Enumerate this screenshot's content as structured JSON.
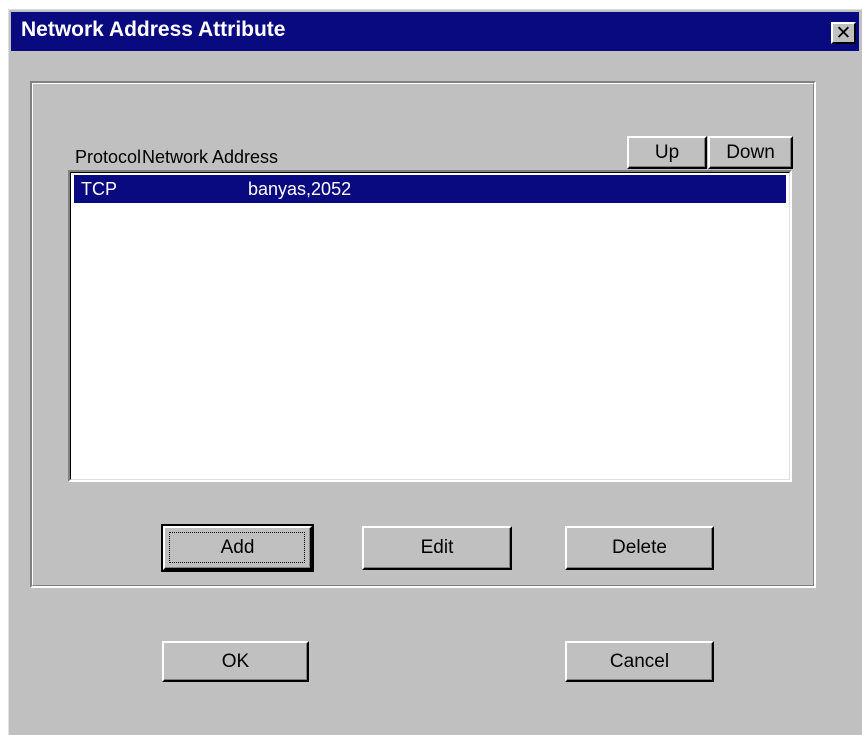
{
  "window": {
    "title": "Network Address Attribute",
    "close_glyph": "✕"
  },
  "list": {
    "headers": {
      "protocol": "Protocol",
      "address": "Network Address"
    },
    "rows": [
      {
        "protocol": "TCP",
        "address": "banyas,2052",
        "selected": true
      }
    ]
  },
  "buttons": {
    "up": "Up",
    "down": "Down",
    "add": "Add",
    "edit": "Edit",
    "delete": "Delete",
    "ok": "OK",
    "cancel": "Cancel"
  },
  "colors": {
    "titlebar": "#0a0a80",
    "face": "#c0c0c0",
    "selection": "#0a0a80"
  }
}
